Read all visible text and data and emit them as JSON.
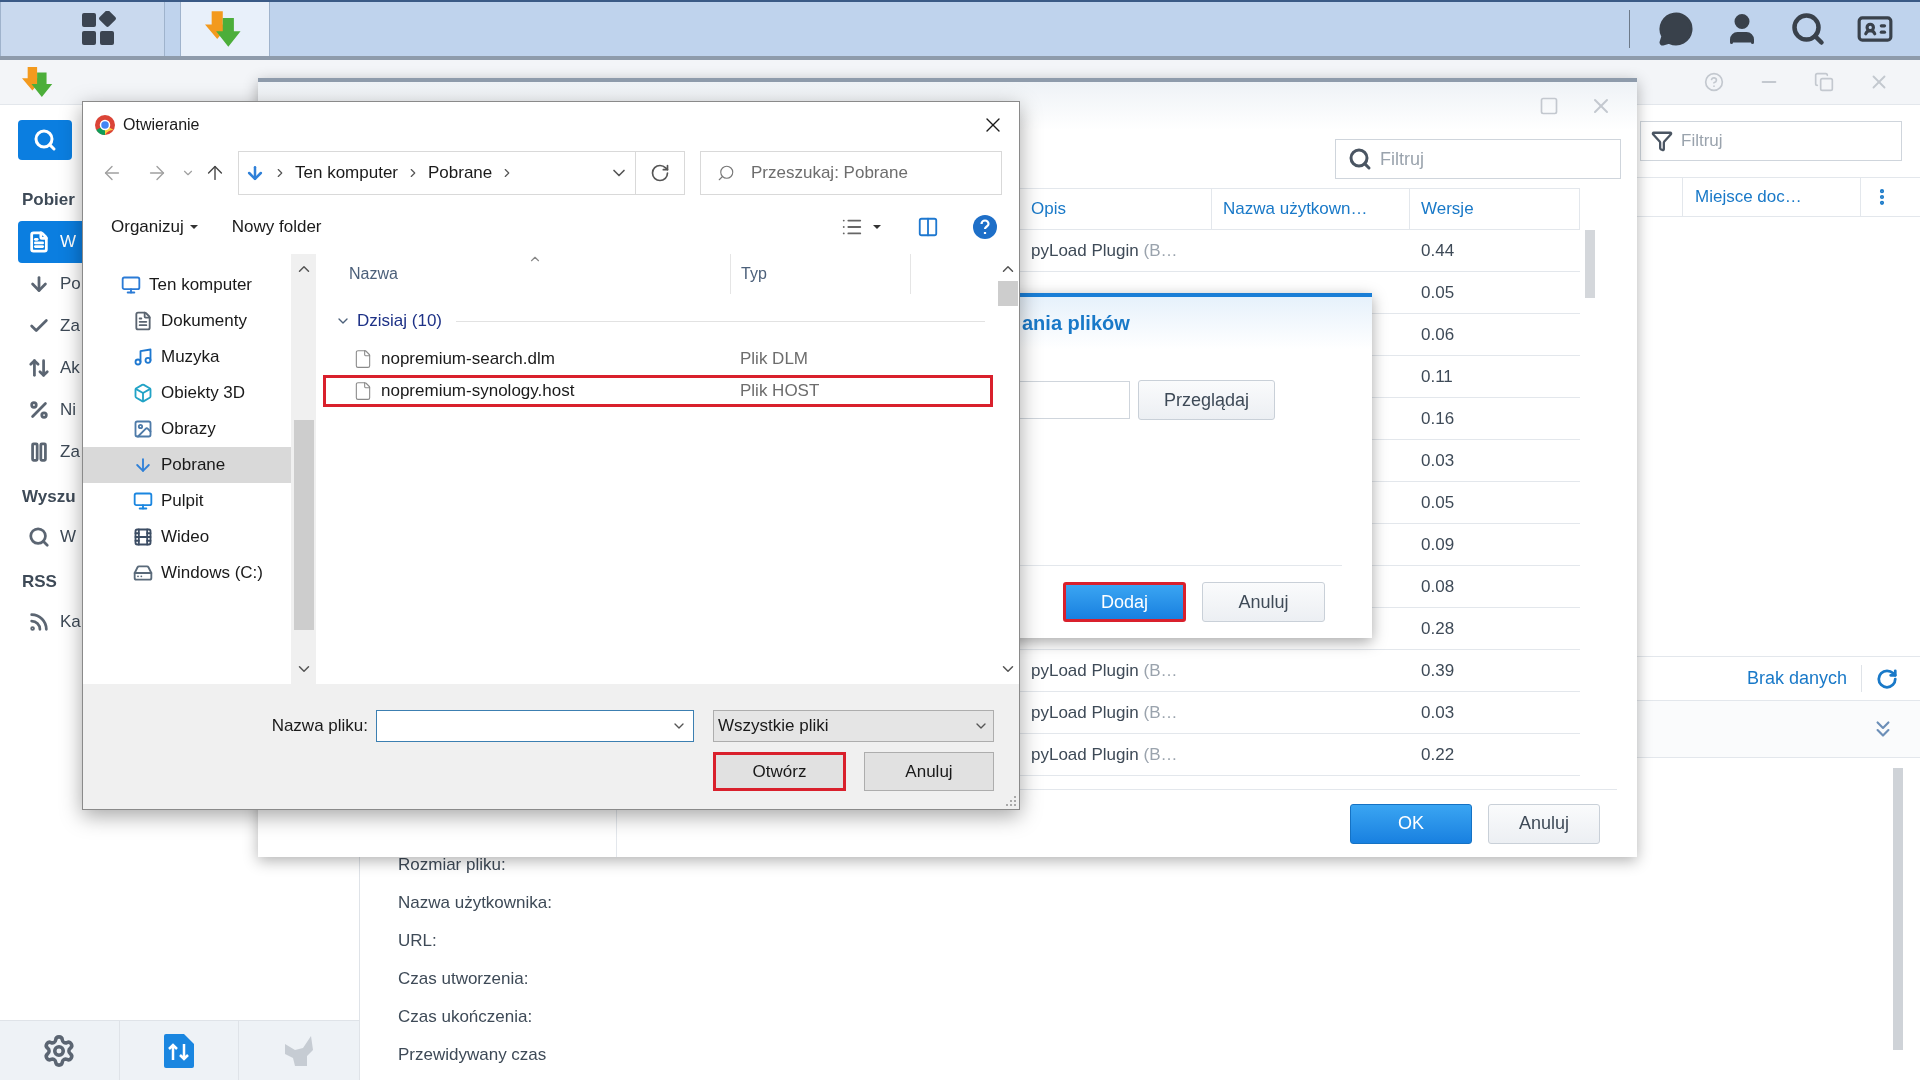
{
  "taskbar": {
    "buttons": [
      {
        "kind": "apps",
        "selected": false
      },
      {
        "kind": "download_station",
        "selected": true
      }
    ]
  },
  "app": {
    "sidebar": {
      "sections": [
        {
          "title": "Pobier",
          "items": [
            {
              "kind": "all",
              "label": "W",
              "selected": true
            },
            {
              "kind": "downloading",
              "label": "Po",
              "selected": false
            },
            {
              "kind": "completed",
              "label": "Za",
              "selected": false
            },
            {
              "kind": "active",
              "label": "Ak",
              "selected": false
            },
            {
              "kind": "inactive",
              "label": "Ni",
              "selected": false
            },
            {
              "kind": "paused",
              "label": "Za",
              "selected": false
            }
          ]
        },
        {
          "title": "Wyszu",
          "items": [
            {
              "kind": "search",
              "label": "W",
              "selected": false
            }
          ]
        },
        {
          "title": "RSS",
          "items": [
            {
              "kind": "rss",
              "label": "Ka",
              "selected": false
            }
          ]
        }
      ]
    },
    "filter_placeholder": "Filtruj",
    "columns": [
      "Miejsce doc…"
    ],
    "status": "Brak danych",
    "details": [
      "Rozmiar pliku:",
      "Nazwa użytkownika:",
      "URL:",
      "Czas utworzenia:",
      "Czas ukończenia:",
      "Przewidywany czas"
    ]
  },
  "settings_window": {
    "filter_placeholder": "Filtruj",
    "columns": [
      "Opis",
      "Nazwa użytkown…",
      "Wersje"
    ],
    "rows": [
      {
        "description": "pyLoad Plugin",
        "note": "(B…",
        "version": "0.44"
      },
      {
        "version": "0.05"
      },
      {
        "version": "0.06"
      },
      {
        "version": "0.11"
      },
      {
        "version": "0.16"
      },
      {
        "version": "0.03"
      },
      {
        "version": "0.05"
      },
      {
        "version": "0.09"
      },
      {
        "version": "0.08"
      },
      {
        "version": "0.28"
      },
      {
        "description": "pyLoad Plugin",
        "note": "(B…",
        "version": "0.39"
      },
      {
        "description": "pyLoad Plugin",
        "note": "(B…",
        "version": "0.03"
      },
      {
        "description": "pyLoad Plugin",
        "note": "(B…",
        "version": "0.22"
      }
    ],
    "buttons": [
      {
        "label": "OK",
        "kind": "primary"
      },
      {
        "label": "Anuluj",
        "kind": "secondary"
      }
    ]
  },
  "add_dialog": {
    "title": "ania plików",
    "browse_button": "Przeglądaj",
    "buttons": [
      {
        "label": "Dodaj",
        "kind": "primary",
        "highlighted": true
      },
      {
        "label": "Anuluj",
        "kind": "secondary",
        "highlighted": false
      }
    ]
  },
  "file_dialog": {
    "title": "Otwieranie",
    "breadcrumb": [
      "Ten komputer",
      "Pobrane"
    ],
    "search_placeholder": "Przeszukaj: Pobrane",
    "toolbar": [
      {
        "label": "Organizuj",
        "kind": "menu"
      },
      {
        "label": "Nowy folder",
        "kind": "action"
      }
    ],
    "nav": [
      {
        "kind": "computer",
        "label": "Ten komputer",
        "selected": false,
        "children": [
          {
            "kind": "documents",
            "label": "Dokumenty",
            "selected": false
          },
          {
            "kind": "music",
            "label": "Muzyka",
            "selected": false
          },
          {
            "kind": "objects3d",
            "label": "Obiekty 3D",
            "selected": false
          },
          {
            "kind": "pictures",
            "label": "Obrazy",
            "selected": false
          },
          {
            "kind": "downloads",
            "label": "Pobrane",
            "selected": true
          },
          {
            "kind": "desktop",
            "label": "Pulpit",
            "selected": false
          },
          {
            "kind": "videos",
            "label": "Wideo",
            "selected": false
          },
          {
            "kind": "drive",
            "label": "Windows (C:)",
            "selected": false
          }
        ]
      }
    ],
    "columns": [
      "Nazwa",
      "Typ"
    ],
    "groups": [
      {
        "label": "Dzisiaj (10)",
        "expanded": true,
        "files": [
          {
            "name": "nopremium-search.dlm",
            "type": "Plik DLM",
            "highlighted": false
          },
          {
            "name": "nopremium-synology.host",
            "type": "Plik HOST",
            "highlighted": true
          }
        ]
      }
    ],
    "filename_label": "Nazwa pliku:",
    "file_type": "Wszystkie pliki",
    "buttons": [
      {
        "label": "Otwórz",
        "highlighted": true
      },
      {
        "label": "Anuluj",
        "highlighted": false
      }
    ]
  }
}
